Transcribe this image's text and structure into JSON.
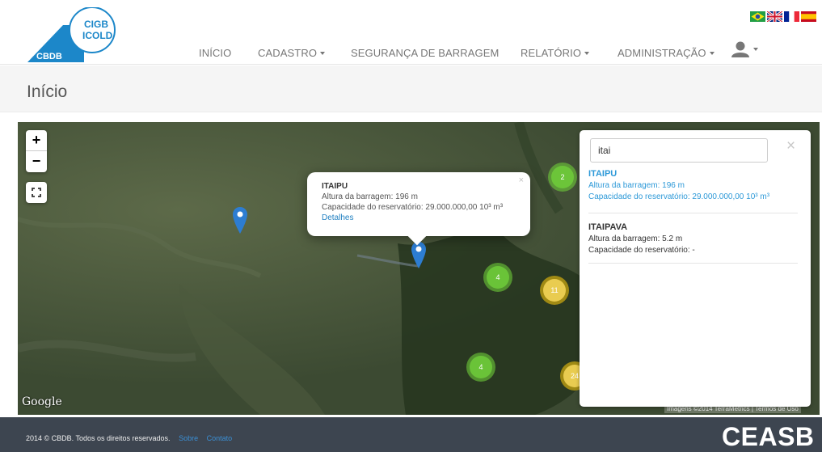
{
  "logo": {
    "line1": "CIGB",
    "line2": "ICOLD",
    "line3": "CBDB"
  },
  "nav": {
    "items": [
      {
        "label": "INÍCIO",
        "dropdown": false
      },
      {
        "label": "CADASTRO",
        "dropdown": true
      },
      {
        "label": "SEGURANÇA DE BARRAGEM",
        "dropdown": false
      },
      {
        "label": "RELATÓRIO",
        "dropdown": true
      },
      {
        "label": "ADMINISTRAÇÃO",
        "dropdown": true
      }
    ],
    "flags": [
      "brazil-flag",
      "uk-flag",
      "france-flag",
      "spain-flag"
    ],
    "user_icon": "user-icon"
  },
  "page": {
    "title": "Início"
  },
  "map": {
    "zoom_in": "+",
    "zoom_out": "−",
    "google_label": "Google",
    "attribution": "Imagens ©2014 TerraMetrics | Termos de Uso",
    "clusters": [
      {
        "count": "2",
        "color": "green"
      },
      {
        "count": "4",
        "color": "green"
      },
      {
        "count": "11",
        "color": "yellow"
      },
      {
        "count": "4",
        "color": "green"
      },
      {
        "count": "24",
        "color": "yellow"
      }
    ],
    "popup": {
      "title": "ITAIPU",
      "height_line": "Altura da barragem: 196 m",
      "capacity_line": "Capacidade do reservatório: 29.000.000,00 10³ m³",
      "link": "Detalhes",
      "close": "×"
    }
  },
  "search": {
    "value": "itai",
    "close": "×",
    "results": [
      {
        "title": "ITAIPU",
        "height": "Altura da barragem: 196 m",
        "capacity": "Capacidade do reservatório: 29.000.000,00 10³ m³",
        "active": true
      },
      {
        "title": "ITAIPAVA",
        "height": "Altura da barragem: 5.2 m",
        "capacity": "Capacidade do reservatório: -",
        "active": false
      }
    ]
  },
  "footer": {
    "copyright": "2014 © CBDB. Todos os direitos reservados.",
    "link_about": "Sobre",
    "link_contact": "Contato",
    "brand": "CEASB"
  },
  "colors": {
    "accent": "#2d99d8",
    "footer_bg": "#3d4550",
    "logo_blue": "#1c87c9"
  }
}
